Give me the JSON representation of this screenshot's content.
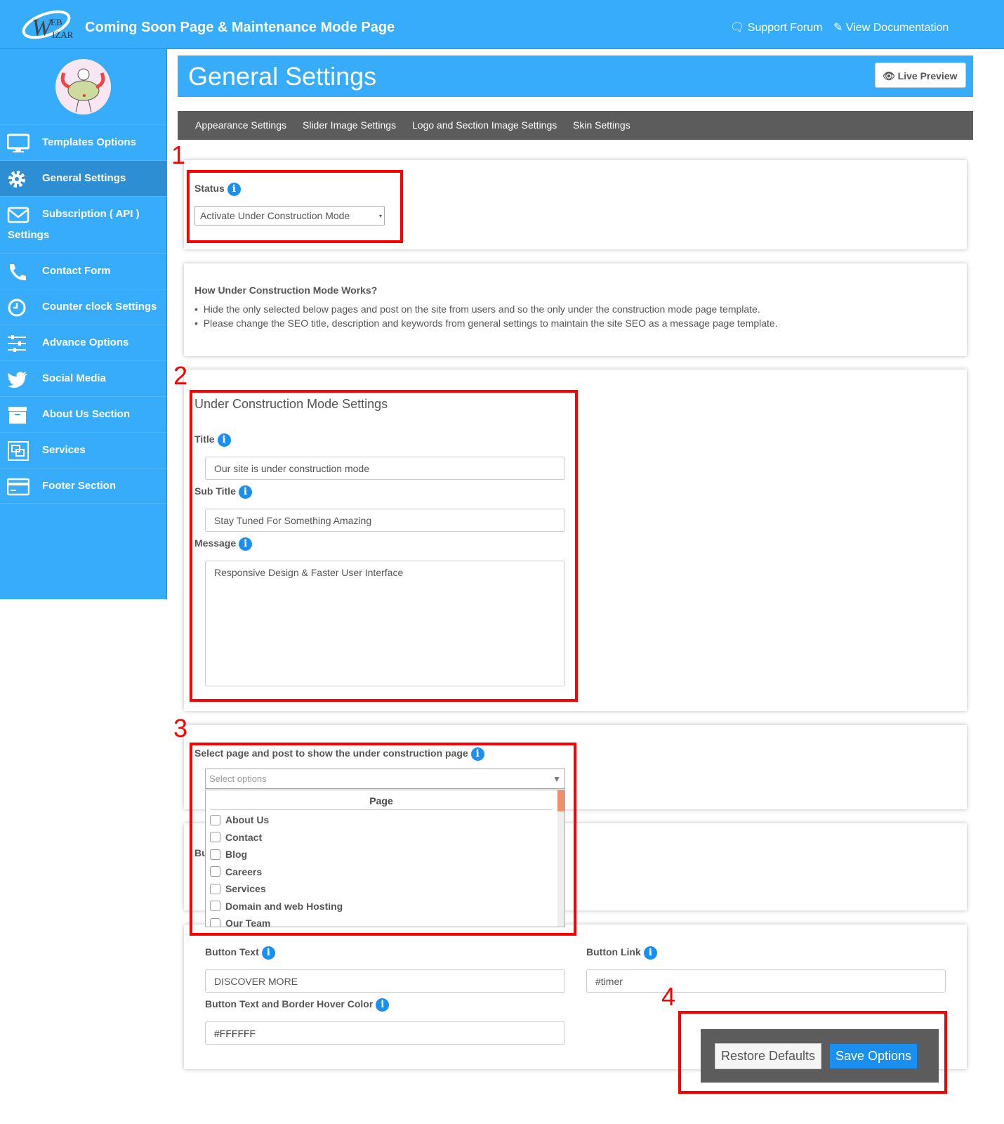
{
  "header": {
    "title": "Coming Soon Page & Maintenance Mode Page",
    "support": "Support Forum",
    "docs": "View Documentation",
    "logo_text": "WEB WIZAR"
  },
  "sidebar": {
    "items": [
      {
        "label": "Templates Options",
        "icon": "monitor-icon"
      },
      {
        "label": "General Settings",
        "icon": "gear-icon",
        "active": true
      },
      {
        "label": "Subscription ( API )",
        "label2": "Settings",
        "icon": "envelope-icon"
      },
      {
        "label": "Contact Form",
        "icon": "phone-icon"
      },
      {
        "label": "Counter clock Settings",
        "icon": "clock-icon"
      },
      {
        "label": "Advance Options",
        "icon": "sliders-icon"
      },
      {
        "label": "Social Media",
        "icon": "twitter-icon"
      },
      {
        "label": "About Us Section",
        "icon": "archive-icon"
      },
      {
        "label": "Services",
        "icon": "object-group-icon"
      },
      {
        "label": "Footer Section",
        "icon": "credit-card-icon"
      }
    ]
  },
  "page": {
    "title": "General Settings",
    "live_preview": "Live Preview"
  },
  "tabs": [
    "Appearance Settings",
    "Slider Image Settings",
    "Logo and Section Image Settings",
    "Skin Settings"
  ],
  "status": {
    "label": "Status",
    "value": "Activate Under Construction Mode"
  },
  "how": {
    "title": "How Under Construction Mode Works?",
    "bullets": [
      "Hide the only selected below pages and post on the site from users and so the only under the construction mode page template.",
      "Please change the SEO title, description and keywords from general settings to maintain the site SEO as a message page template."
    ]
  },
  "ucm": {
    "heading": "Under Construction Mode Settings",
    "title_label": "Title",
    "title_value": "Our site is under construction mode",
    "subtitle_label": "Sub Title",
    "subtitle_value": "Stay Tuned For Something Amazing",
    "message_label": "Message",
    "message_value": "Responsive Design & Faster User Interface"
  },
  "select": {
    "label": "Select page and post to show the under construction page",
    "placeholder": "Select options",
    "group": "Page",
    "options": [
      "About Us",
      "Contact",
      "Blog",
      "Careers",
      "Services",
      "Domain and web Hosting",
      "Our Team"
    ],
    "hidden_label_fragment": "Bu"
  },
  "button": {
    "text_label": "Button Text",
    "text_value": "DISCOVER MORE",
    "link_label": "Button Link",
    "link_value": "#timer",
    "hover_label": "Button Text and Border Hover Color",
    "hover_value": "#FFFFFF"
  },
  "actions": {
    "restore": "Restore Defaults",
    "save": "Save Options"
  },
  "annotations": [
    "1",
    "2",
    "3",
    "4"
  ],
  "colors": {
    "primary": "#36acfb",
    "annotation": "#ff0000",
    "tabbar": "#5c5c5c",
    "save": "#1a8ff0"
  }
}
